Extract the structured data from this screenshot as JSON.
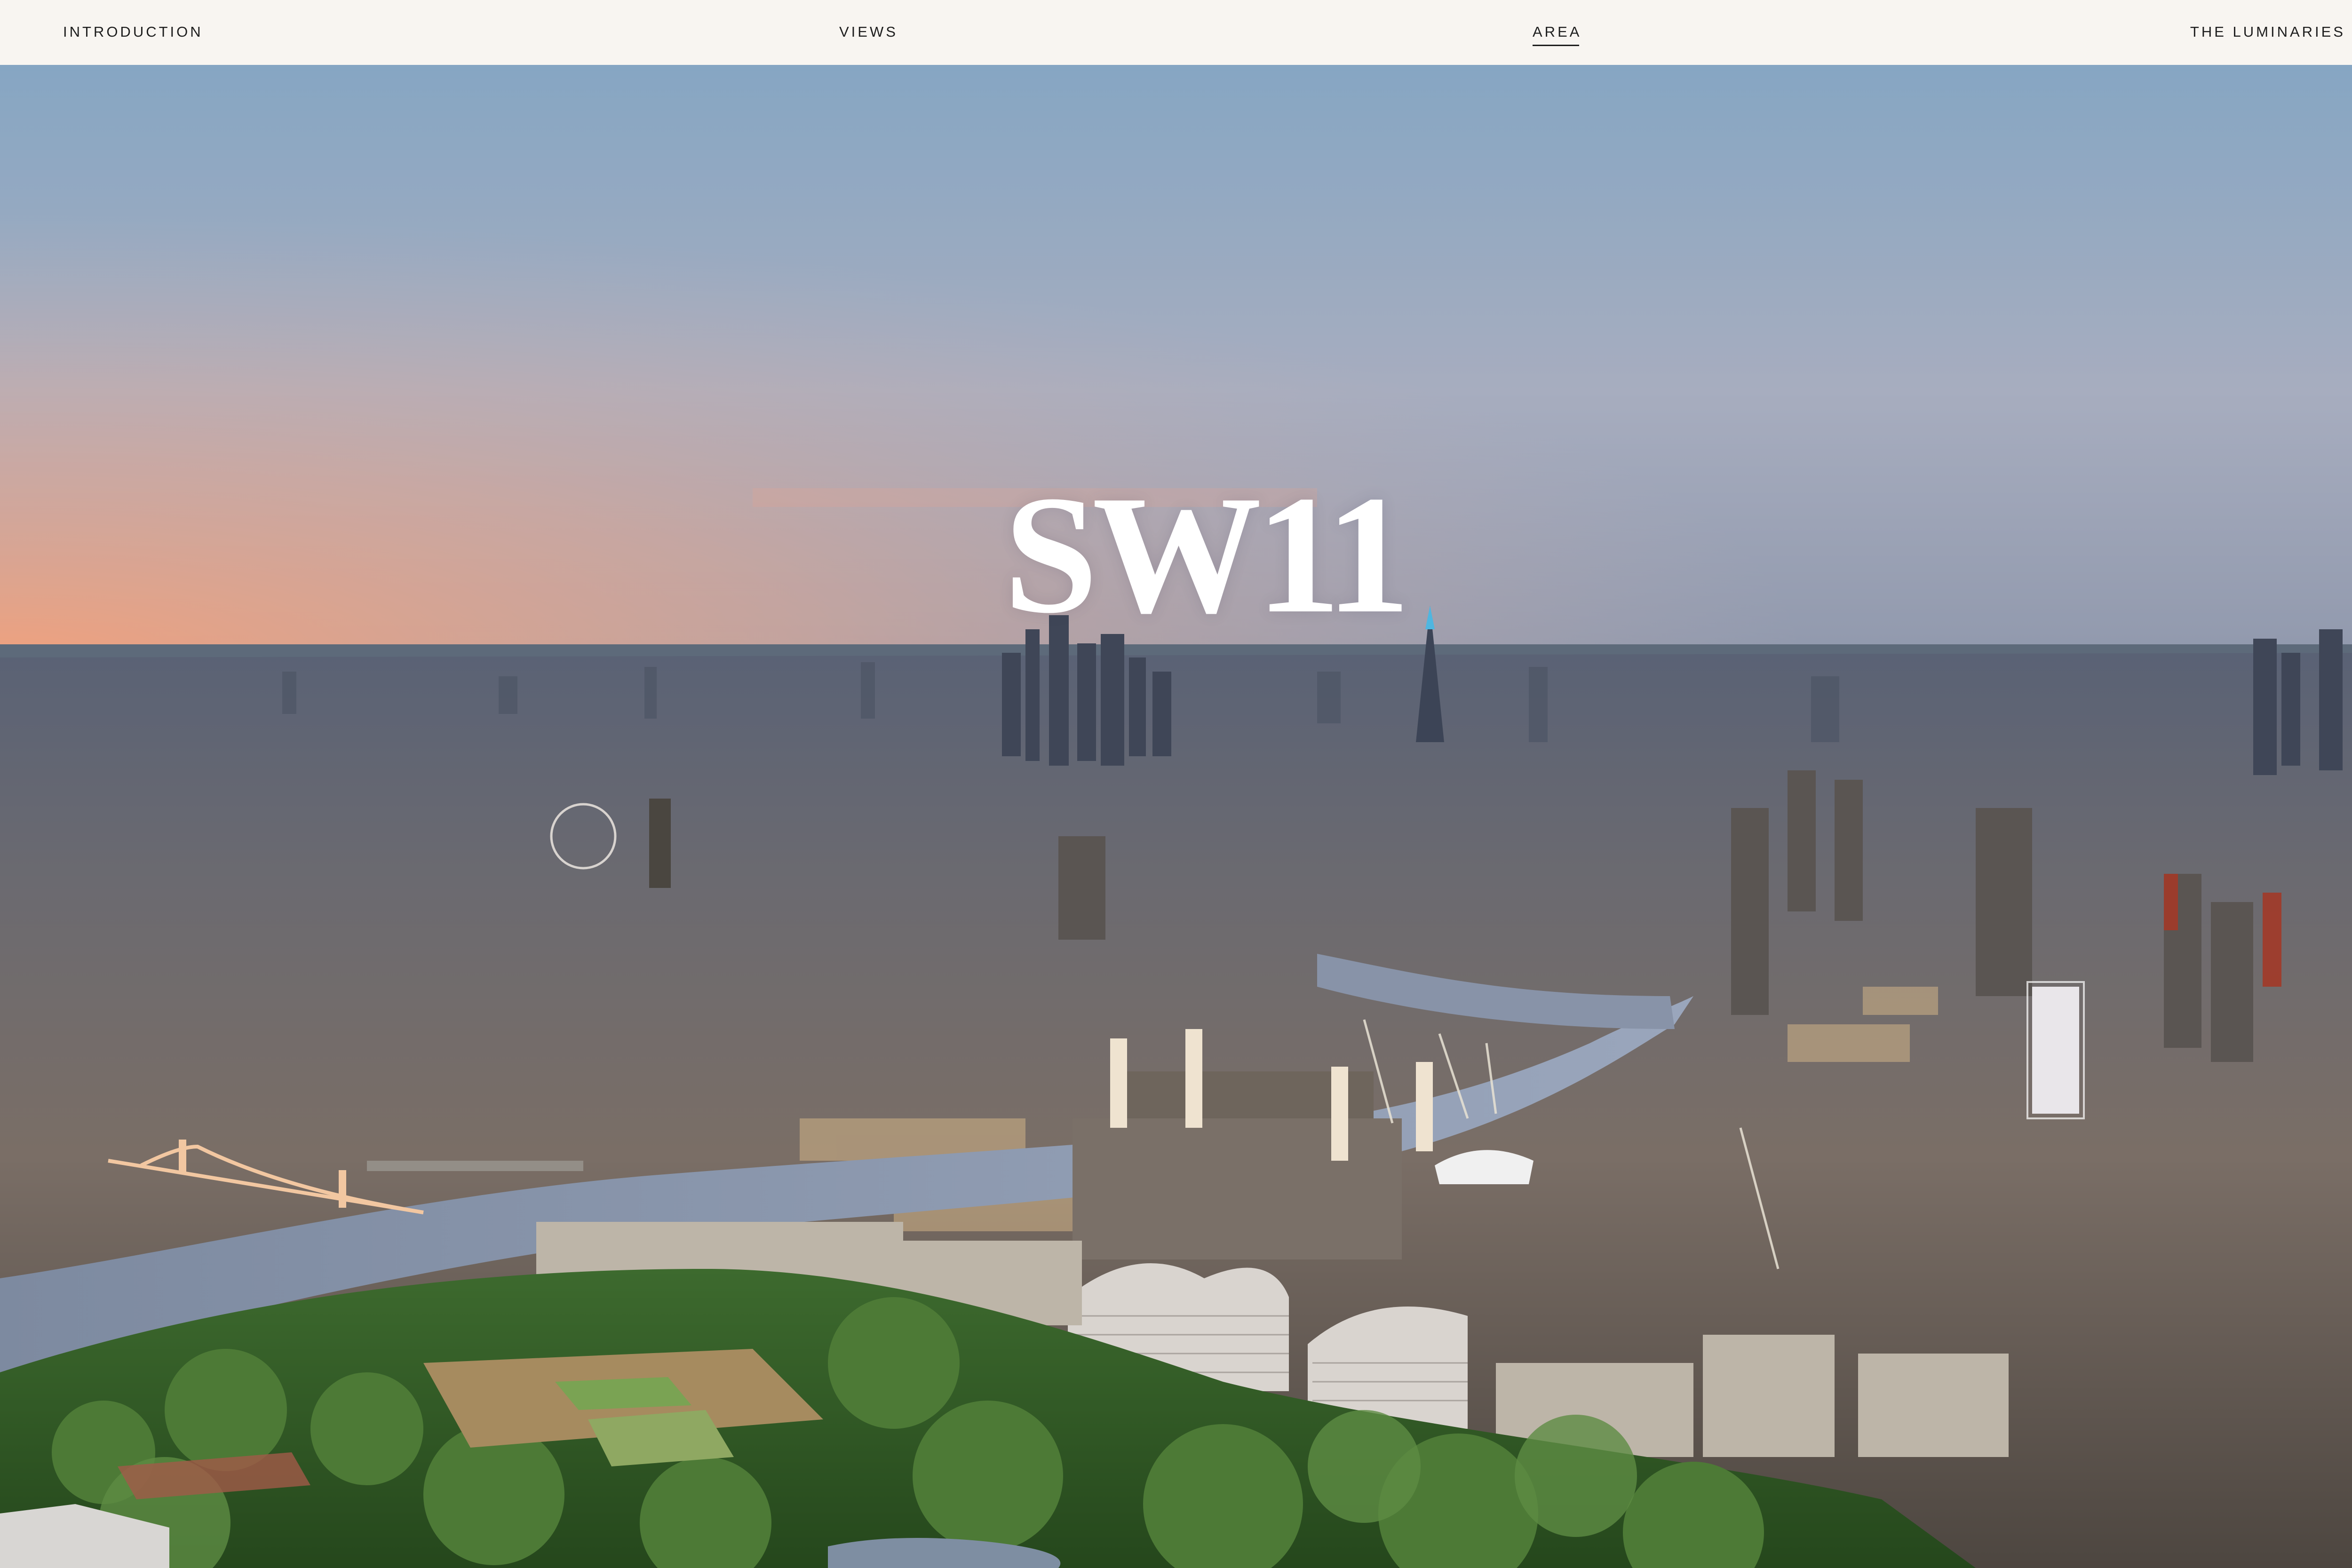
{
  "nav": {
    "introduction": "INTRODUCTION",
    "views": "VIEWS",
    "area": "AREA",
    "luminaries": "THE LUMINARIES",
    "active": "area"
  },
  "hero": {
    "title": "SW11",
    "background": "aerial-london-skyline-sunset-photo"
  },
  "colors": {
    "nav_background": "#f8f5f1",
    "nav_text": "#1d1d1d",
    "sky_top": "#7f9fbf",
    "sky_sunset": "#f0a27e",
    "title_text": "#ffffff"
  }
}
